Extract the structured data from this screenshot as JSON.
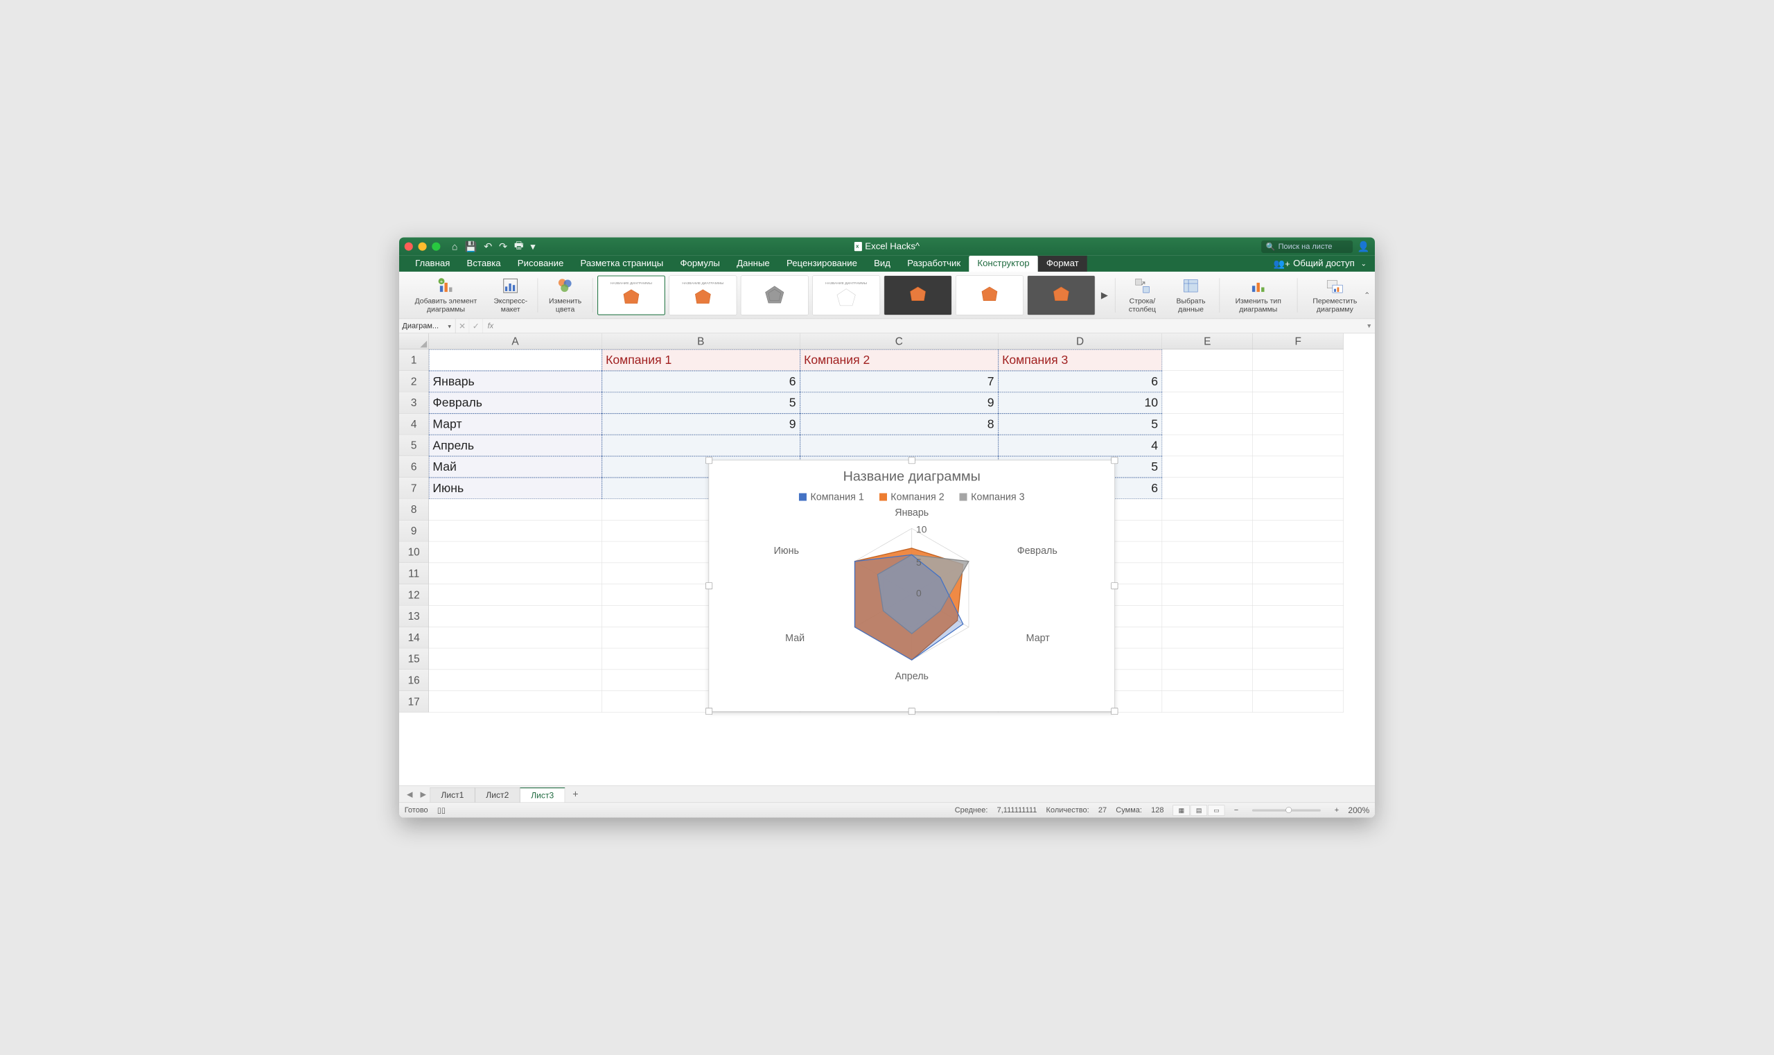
{
  "app": {
    "title": "Excel Hacks^",
    "search_placeholder": "Поиск на листе",
    "share": "Общий доступ"
  },
  "tabs": [
    "Главная",
    "Вставка",
    "Рисование",
    "Разметка страницы",
    "Формулы",
    "Данные",
    "Рецензирование",
    "Вид",
    "Разработчик",
    "Конструктор",
    "Формат"
  ],
  "active_tab": "Конструктор",
  "ribbon": {
    "add_element": "Добавить элемент диаграммы",
    "quick_layout": "Экспресс-макет",
    "change_colors": "Изменить цвета",
    "switch_rowcol": "Строка/столбец",
    "select_data": "Выбрать данные",
    "change_type": "Изменить тип диаграммы",
    "move_chart": "Переместить диаграмму"
  },
  "namebox": "Диаграм...",
  "columns": [
    "A",
    "B",
    "C",
    "D",
    "E",
    "F"
  ],
  "rows": [
    "1",
    "2",
    "3",
    "4",
    "5",
    "6",
    "7",
    "8",
    "9",
    "10",
    "11",
    "12",
    "13",
    "14",
    "15",
    "16",
    "17"
  ],
  "sheet_data": {
    "headers": [
      "",
      "Компания 1",
      "Компания 2",
      "Компания 3"
    ],
    "months": [
      "Январь",
      "Февраль",
      "Март",
      "Апрель",
      "Май",
      "Июнь"
    ],
    "values": {
      "row1": [
        "6",
        "7",
        "6"
      ],
      "row2": [
        "5",
        "9",
        "10"
      ],
      "row3": [
        "9",
        "8",
        "5"
      ],
      "row4": [
        "",
        "",
        "4"
      ],
      "row5": [
        "",
        "",
        "5"
      ],
      "row6": [
        "",
        "",
        "6"
      ]
    }
  },
  "chart": {
    "title": "Название диаграммы",
    "legend": [
      "Компания 1",
      "Компания 2",
      "Компания 3"
    ],
    "axis_labels": [
      "Январь",
      "Февраль",
      "Март",
      "Апрель",
      "Май",
      "Июнь"
    ],
    "ticks": [
      "10",
      "5",
      "0"
    ]
  },
  "chart_data": {
    "type": "radar",
    "categories": [
      "Январь",
      "Февраль",
      "Март",
      "Апрель",
      "Май",
      "Июнь"
    ],
    "series": [
      {
        "name": "Компания 1",
        "values": [
          6,
          5,
          9,
          null,
          null,
          null
        ],
        "color": "#4472c4"
      },
      {
        "name": "Компания 2",
        "values": [
          7,
          9,
          8,
          null,
          null,
          null
        ],
        "color": "#ed7d31"
      },
      {
        "name": "Компания 3",
        "values": [
          6,
          10,
          5,
          4,
          5,
          6
        ],
        "color": "#a5a5a5"
      }
    ],
    "max": 10,
    "ticks": [
      0,
      5,
      10
    ],
    "title": "Название диаграммы"
  },
  "sheet_tabs": [
    "Лист1",
    "Лист2",
    "Лист3"
  ],
  "active_sheet": "Лист3",
  "status": {
    "ready": "Готово",
    "avg_label": "Среднее:",
    "avg_val": "7,111111111",
    "count_label": "Количество:",
    "count_val": "27",
    "sum_label": "Сумма:",
    "sum_val": "128",
    "zoom": "200%"
  }
}
